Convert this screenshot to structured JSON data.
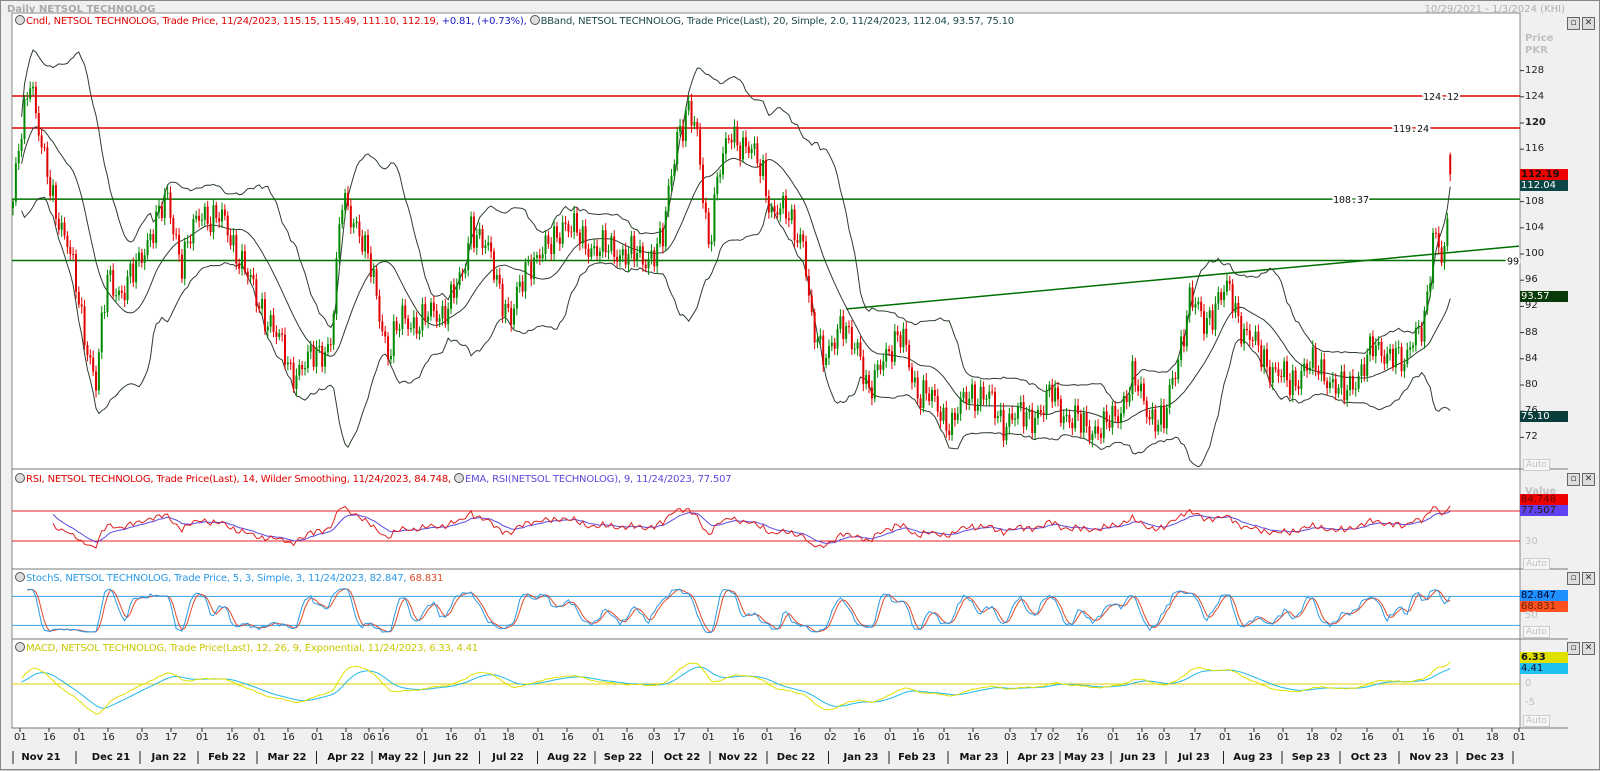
{
  "window": {
    "title": "Daily NETSOL TECHNOLOG",
    "date_range": "10/29/2021 - 1/3/2024 (KHI)",
    "restore_icon": "restore-icon",
    "close_icon": "close-icon"
  },
  "main_panel": {
    "header_cndl": "Cndl, NETSOL TECHNOLOG, Trade Price, 11/24/2023, 115.15, 115.49, 111.10, 112.19,",
    "header_change": "+0.81, (+0.73%),",
    "header_bband": "BBand, NETSOL TECHNOLOG, Trade Price(Last), 20, Simple, 2.0, 11/24/2023, 112.04, 93.57, 75.10",
    "axis_title": "Price",
    "axis_unit": "PKR",
    "auto": "Auto",
    "ticks": [
      "128",
      "124",
      "120",
      "116",
      "112",
      "108",
      "104",
      "100",
      "96",
      "92",
      "88",
      "84",
      "80",
      "76",
      "72"
    ],
    "labels": {
      "close": "112.19",
      "bb_mid": "112.04",
      "bb_upper": "93.57",
      "bb_lower": "75.10"
    },
    "line_labels": {
      "r1": "124.12",
      "r2": "119.24",
      "g1": "108.37",
      "g2": "99"
    }
  },
  "rsi_panel": {
    "header_rsi": "RSI, NETSOL TECHNOLOG, Trade Price(Last), 14, Wilder Smoothing, 11/24/2023, 84.748,",
    "header_ema": "EMA, RSI(NETSOL TECHNOLOG), 9, 11/24/2023, 77.507",
    "axis_title": "Value",
    "rsi_value": "84.748",
    "ema_value": "77.507",
    "tick_30": "30",
    "auto": "Auto"
  },
  "stoch_panel": {
    "header": "StochS, NETSOL TECHNOLOG, Trade Price, 5, 3, Simple, 3, 11/24/2023, 82.847,",
    "header_d": "68.831",
    "k_value": "82.847",
    "d_value": "68.831",
    "tick_50": "50",
    "auto": "Auto"
  },
  "macd_panel": {
    "header": "MACD, NETSOL TECHNOLOG, Trade Price(Last), 12, 26, 9, Exponential, 11/24/2023, 6.33, 4.41",
    "macd_value": "6.33",
    "signal_value": "4.41",
    "tick_0": "0",
    "tick_m5": "-5",
    "auto": "Auto"
  },
  "x_axis": {
    "days": [
      "01",
      "16",
      "01",
      "16",
      "03",
      "17",
      "01",
      "16",
      "01",
      "16",
      "01",
      "18",
      "06",
      "16",
      "01",
      "16",
      "01",
      "18",
      "01",
      "16",
      "01",
      "16",
      "03",
      "17",
      "01",
      "16",
      "01",
      "16",
      "02",
      "16",
      "01",
      "16",
      "01",
      "16",
      "03",
      "17",
      "02",
      "16",
      "01",
      "16",
      "03",
      "17",
      "01",
      "16",
      "01",
      "18",
      "02",
      "16",
      "01",
      "16",
      "01",
      "18",
      "01"
    ],
    "months": [
      "Nov 21",
      "Dec 21",
      "Jan 22",
      "Feb 22",
      "Mar 22",
      "Apr 22",
      "May 22",
      "Jun 22",
      "Jul 22",
      "Aug 22",
      "Sep 22",
      "Oct 22",
      "Nov 22",
      "Dec 22",
      "Jan 23",
      "Feb 23",
      "Mar 23",
      "Apr 23",
      "May 23",
      "Jun 23",
      "Jul 23",
      "Aug 23",
      "Sep 23",
      "Oct 23",
      "Nov 23",
      "Dec 23"
    ]
  },
  "chart_data": {
    "type": "candlestick",
    "title": "Daily NETSOL TECHNOLOG",
    "ylabel": "Price PKR",
    "ylim": [
      70,
      131
    ],
    "x_unit": "trading-day index",
    "close_keypoints": [
      [
        0,
        108
      ],
      [
        3,
        118.8
      ],
      [
        6,
        128
      ],
      [
        10,
        115.7
      ],
      [
        13,
        109.6
      ],
      [
        19,
        102
      ],
      [
        24,
        89.8
      ],
      [
        29,
        80.6
      ],
      [
        33,
        95.9
      ],
      [
        38,
        94.4
      ],
      [
        43,
        97.4
      ],
      [
        48,
        103.5
      ],
      [
        54,
        108
      ],
      [
        59,
        99
      ],
      [
        66,
        106.6
      ],
      [
        73,
        105
      ],
      [
        80,
        99
      ],
      [
        85,
        92.8
      ],
      [
        90,
        89.8
      ],
      [
        97,
        82
      ],
      [
        104,
        83.7
      ],
      [
        111,
        86.7
      ],
      [
        115,
        108
      ],
      [
        120,
        105
      ],
      [
        125,
        97.4
      ],
      [
        131,
        85.2
      ],
      [
        136,
        89.8
      ],
      [
        143,
        89.8
      ],
      [
        150,
        91.3
      ],
      [
        157,
        95.9
      ],
      [
        160,
        105
      ],
      [
        167,
        99
      ],
      [
        174,
        89.8
      ],
      [
        180,
        99
      ],
      [
        187,
        100.5
      ],
      [
        192,
        105
      ],
      [
        199,
        102
      ],
      [
        206,
        100.5
      ],
      [
        213,
        100.5
      ],
      [
        220,
        99
      ],
      [
        227,
        102
      ],
      [
        232,
        118.8
      ],
      [
        236,
        121.8
      ],
      [
        239,
        117.3
      ],
      [
        243,
        102
      ],
      [
        246,
        111
      ],
      [
        251,
        118.8
      ],
      [
        257,
        115.7
      ],
      [
        262,
        112.7
      ],
      [
        265,
        106.6
      ],
      [
        271,
        105.8
      ],
      [
        276,
        102
      ],
      [
        279,
        88.2
      ],
      [
        283,
        85.2
      ],
      [
        290,
        88.2
      ],
      [
        295,
        86.7
      ],
      [
        299,
        77.5
      ],
      [
        304,
        85.2
      ],
      [
        311,
        86.7
      ],
      [
        316,
        79.1
      ],
      [
        323,
        76.8
      ],
      [
        328,
        73.7
      ],
      [
        334,
        79.1
      ],
      [
        341,
        77.5
      ],
      [
        346,
        74.5
      ],
      [
        353,
        75.3
      ],
      [
        360,
        76
      ],
      [
        363,
        79.1
      ],
      [
        369,
        74.5
      ],
      [
        376,
        73.7
      ],
      [
        381,
        73
      ],
      [
        386,
        76
      ],
      [
        391,
        80.6
      ],
      [
        397,
        76
      ],
      [
        402,
        73.7
      ],
      [
        405,
        80.6
      ],
      [
        411,
        92.8
      ],
      [
        416,
        89.8
      ],
      [
        421,
        92.8
      ],
      [
        425,
        94.4
      ],
      [
        430,
        88.2
      ],
      [
        435,
        85.2
      ],
      [
        441,
        82
      ],
      [
        446,
        79.9
      ],
      [
        451,
        82.9
      ],
      [
        458,
        82
      ],
      [
        465,
        78.3
      ],
      [
        470,
        82
      ],
      [
        475,
        85.2
      ],
      [
        482,
        85.2
      ],
      [
        486,
        82
      ],
      [
        489,
        88.2
      ],
      [
        493,
        89.8
      ],
      [
        495,
        95.9
      ],
      [
        496,
        102
      ],
      [
        500,
        100.5
      ],
      [
        502,
        112.19
      ]
    ],
    "last_bar": {
      "date": "11/24/2023",
      "open": 115.15,
      "high": 115.49,
      "low": 111.1,
      "close": 112.19,
      "change": 0.81,
      "change_pct": 0.73
    },
    "horizontal_lines": [
      {
        "value": 124.12,
        "color": "#e00000"
      },
      {
        "value": 119.24,
        "color": "#e00000"
      },
      {
        "value": 108.37,
        "color": "#007000"
      },
      {
        "value": 99,
        "color": "#007000"
      }
    ],
    "trendline": {
      "from": [
        291,
        91.6
      ],
      "to": [
        526,
        101.2
      ],
      "color": "#007000"
    },
    "indicators": {
      "bband": {
        "period": 20,
        "stddev": 2.0,
        "mid": 112.04,
        "upper": 93.57,
        "lower": 75.1
      },
      "rsi": {
        "period": 14,
        "value": 84.748,
        "ema_period": 9,
        "ema_value": 77.507,
        "levels": [
          70,
          30
        ]
      },
      "stoch": {
        "k": 5,
        "d": 3,
        "smooth": 3,
        "k_value": 82.847,
        "d_value": 68.831,
        "levels": [
          80,
          20
        ]
      },
      "macd": {
        "fast": 12,
        "slow": 26,
        "signal": 9,
        "macd": 6.33,
        "signal_value": 4.41
      }
    },
    "colors": {
      "up": "#008800",
      "down": "#e00000",
      "bband": "#2d3d2d",
      "rsi": "#e02020",
      "rsi_ema": "#5a4ae0",
      "stoch_k": "#2a9ae8",
      "stoch_d": "#e04a2a",
      "macd": "#e0e000",
      "macd_signal": "#20b8e8"
    }
  }
}
